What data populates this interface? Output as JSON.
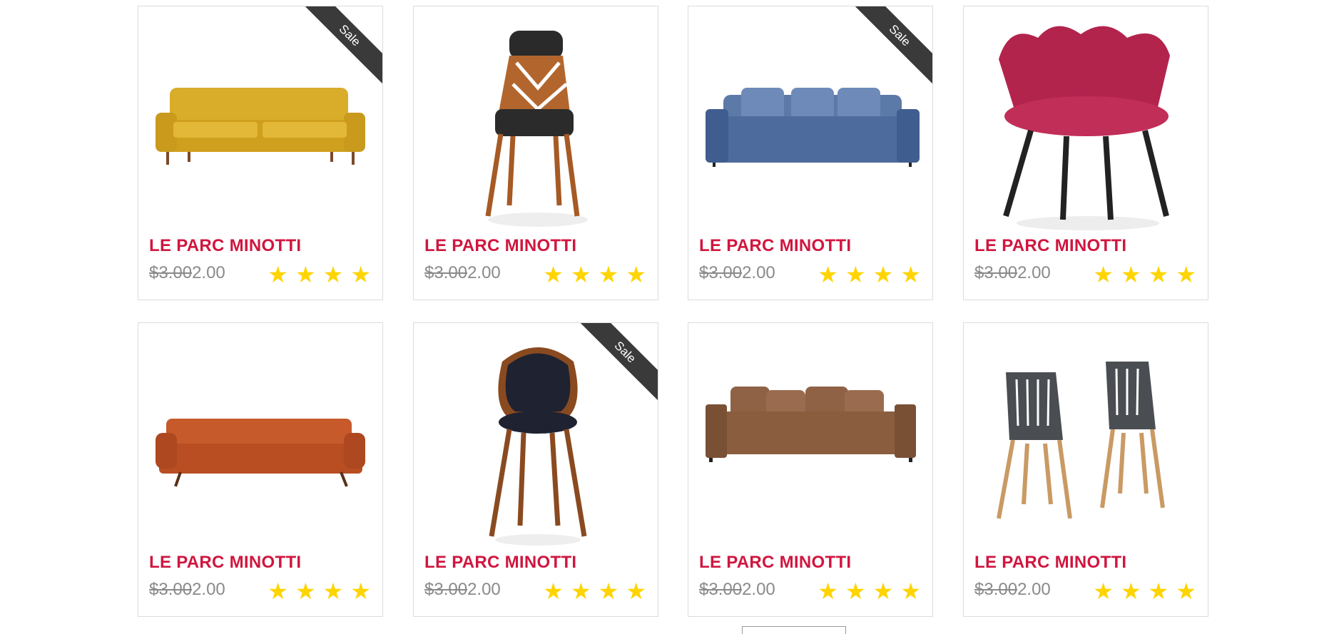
{
  "products": [
    {
      "title": "LE PARC MINOTTI",
      "old_price": "$3.00",
      "price": "2.00",
      "sale": true,
      "sale_label": "Sale",
      "stars": 4,
      "image": "yellow-sofa",
      "color": "#d9ac2a"
    },
    {
      "title": "LE PARC MINOTTI",
      "old_price": "$3.00",
      "price": "2.00",
      "sale": false,
      "sale_label": "",
      "stars": 4,
      "image": "wood-chair-dark-seat",
      "color": "#2a2a2a"
    },
    {
      "title": "LE PARC MINOTTI",
      "old_price": "$3.00",
      "price": "2.00",
      "sale": true,
      "sale_label": "Sale",
      "stars": 4,
      "image": "blue-sofa",
      "color": "#4d6b9c"
    },
    {
      "title": "LE PARC MINOTTI",
      "old_price": "$3.00",
      "price": "2.00",
      "sale": false,
      "sale_label": "",
      "stars": 4,
      "image": "pink-shell-chair",
      "color": "#b3244d"
    },
    {
      "title": "LE PARC MINOTTI",
      "old_price": "$3.00",
      "price": "2.00",
      "sale": false,
      "sale_label": "",
      "stars": 4,
      "image": "orange-sofa",
      "color": "#c65a2b"
    },
    {
      "title": "LE PARC MINOTTI",
      "old_price": "$3.00",
      "price": "2.00",
      "sale": true,
      "sale_label": "Sale",
      "stars": 4,
      "image": "bentwood-chair",
      "color": "#1f2230"
    },
    {
      "title": "LE PARC MINOTTI",
      "old_price": "$3.00",
      "price": "2.00",
      "sale": false,
      "sale_label": "",
      "stars": 4,
      "image": "brown-sofa",
      "color": "#8a5d3f"
    },
    {
      "title": "LE PARC MINOTTI",
      "old_price": "$3.00",
      "price": "2.00",
      "sale": false,
      "sale_label": "",
      "stars": 4,
      "image": "grey-chairs-pair",
      "color": "#4a4d52"
    }
  ],
  "colors": {
    "title": "#d0163f",
    "star": "#ffd400",
    "ribbon": "#3a3a3a",
    "price": "#8a8a8a"
  }
}
